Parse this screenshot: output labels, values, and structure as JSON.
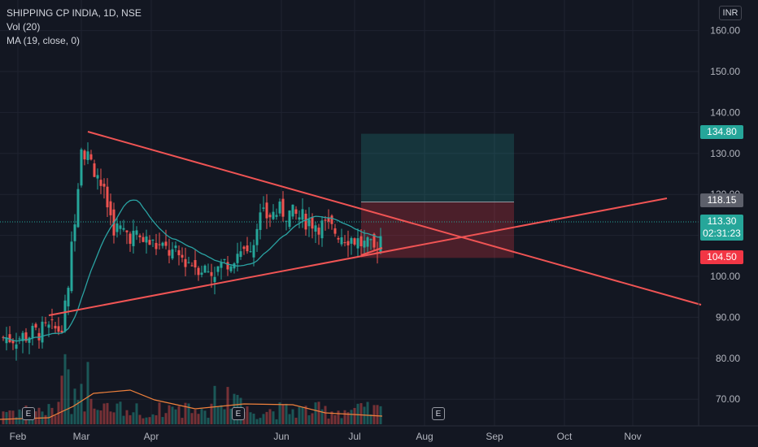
{
  "legend": {
    "symbol": "SHIPPING CP INDIA, 1D, NSE",
    "volume": "Vol (20)",
    "ma": "MA (19, close, 0)"
  },
  "currency": "INR",
  "price_tags": {
    "stop": "104.50",
    "entry": "118.15",
    "last": "113.30",
    "countdown": "02:31:23",
    "target": "134.80"
  },
  "events": [
    "E",
    "E",
    "E"
  ],
  "colors": {
    "background": "#131722",
    "up": "#26a69a",
    "down": "#ef5350",
    "trendline": "#f05454",
    "ma": "#2aa3a3",
    "volume_ma": "#f0813c"
  },
  "chart_data": {
    "type": "candlestick",
    "title": "SHIPPING CP INDIA, 1D, NSE",
    "x_ticks": [
      "Feb",
      "Mar",
      "Apr",
      "Jun",
      "Jul",
      "Aug",
      "Sep",
      "Oct",
      "Nov"
    ],
    "y_ticks": [
      "70.00",
      "80.00",
      "90.00",
      "100.00",
      "110.00",
      "120.00",
      "130.00",
      "140.00",
      "150.00",
      "160.00"
    ],
    "ylim": [
      63,
      167
    ],
    "grid": true,
    "close_series": [
      {
        "date": "Feb 1",
        "close": 85
      },
      {
        "date": "Feb 8",
        "close": 86
      },
      {
        "date": "Feb 15",
        "close": 87
      },
      {
        "date": "Feb 22",
        "close": 87
      },
      {
        "date": "Feb 25",
        "close": 99
      },
      {
        "date": "Mar 1",
        "close": 132
      },
      {
        "date": "Mar 8",
        "close": 125
      },
      {
        "date": "Mar 15",
        "close": 112
      },
      {
        "date": "Apr 1",
        "close": 108
      },
      {
        "date": "Apr 15",
        "close": 101
      },
      {
        "date": "Apr 25",
        "close": 109
      },
      {
        "date": "May 5",
        "close": 122
      },
      {
        "date": "May 15",
        "close": 113
      },
      {
        "date": "Jun 1",
        "close": 116
      },
      {
        "date": "Jun 15",
        "close": 113
      },
      {
        "date": "Jul 1",
        "close": 109
      },
      {
        "date": "Jul 10",
        "close": 106
      },
      {
        "date": "Jul 14",
        "close": 113.3
      }
    ],
    "position": {
      "stop": 104.5,
      "entry": 118.15,
      "target": 134.8,
      "last": 113.3
    }
  }
}
